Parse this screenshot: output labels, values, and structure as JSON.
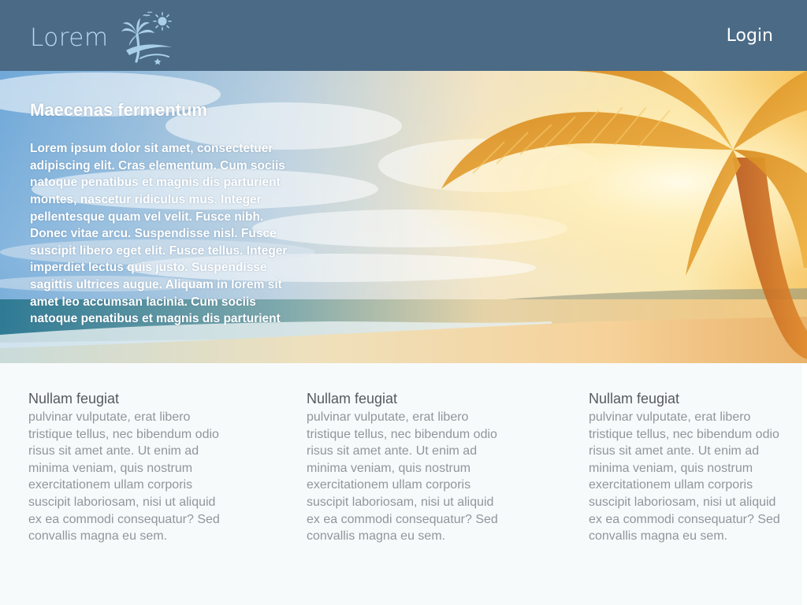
{
  "header": {
    "logo_text": "Lorem",
    "logo_icon": "palm-tree-sun-icon",
    "login_label": "Login",
    "background": "#4b6a85"
  },
  "hero": {
    "image": "tropical-beach-sunset-palm",
    "title": "Maecenas fermentum",
    "body": "Lorem ipsum dolor sit amet, consectetuer adipiscing elit. Cras elementum. Cum sociis natoque penatibus et magnis dis parturient montes, nascetur ridiculus mus. Integer pellentesque quam vel velit. Fusce nibh. Donec vitae arcu. Suspendisse nisl. Fusce suscipit libero eget elit. Fusce tellus. Integer imperdiet lectus quis justo. Suspendisse sagittis ultrices augue. Aliquam in lorem sit amet leo accumsan lacinia. Cum sociis natoque penatibus et magnis dis parturient"
  },
  "columns": [
    {
      "heading": "Nullam feugiat",
      "text": "pulvinar vulputate, erat libero tristique tellus, nec bibendum odio risus sit amet ante. Ut enim ad minima veniam, quis nostrum exercitationem ullam corporis suscipit laboriosam, nisi ut aliquid ex ea commodi consequatur? Sed convallis magna eu sem."
    },
    {
      "heading": "Nullam feugiat",
      "text": "pulvinar vulputate, erat libero tristique tellus, nec bibendum odio risus sit amet ante. Ut enim ad minima veniam, quis nostrum exercitationem ullam corporis suscipit laboriosam, nisi ut aliquid ex ea commodi consequatur? Sed convallis magna eu sem."
    },
    {
      "heading": "Nullam feugiat",
      "text": "pulvinar vulputate, erat libero tristique tellus, nec bibendum odio risus sit amet ante. Ut enim ad minima veniam, quis nostrum exercitationem ullam corporis suscipit laboriosam, nisi ut aliquid ex ea commodi consequatur? Sed convallis magna eu sem."
    }
  ]
}
